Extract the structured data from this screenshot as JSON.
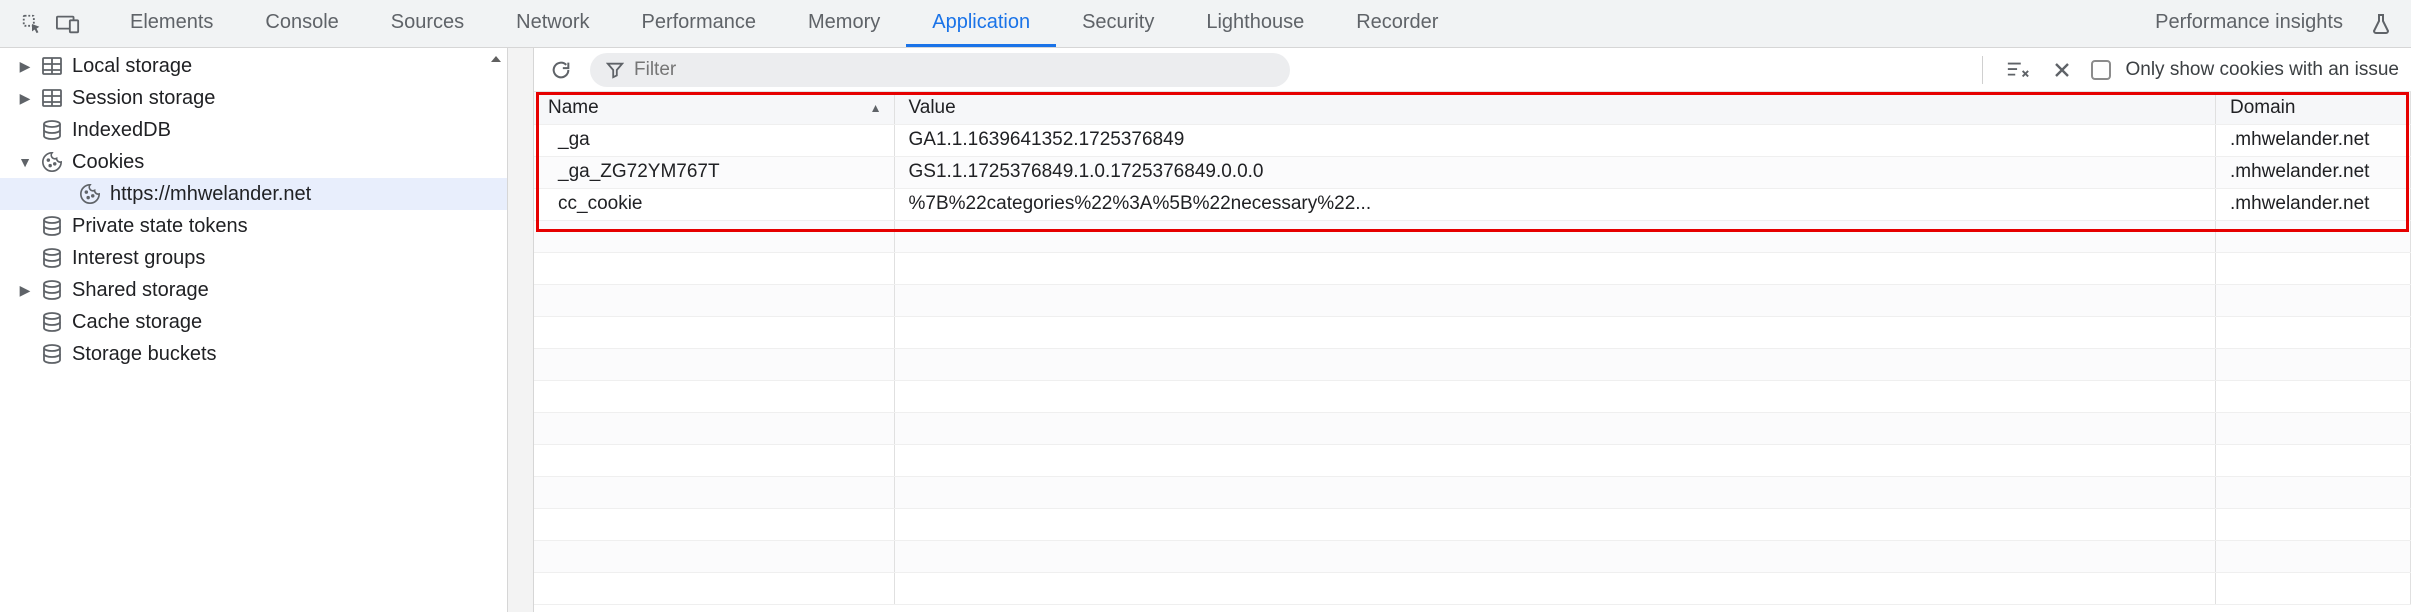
{
  "tabs": {
    "elements": "Elements",
    "console": "Console",
    "sources": "Sources",
    "network": "Network",
    "performance": "Performance",
    "memory": "Memory",
    "application": "Application",
    "security": "Security",
    "lighthouse": "Lighthouse",
    "recorder": "Recorder",
    "perf_insights": "Performance insights"
  },
  "active_tab": "application",
  "sidebar": {
    "items": [
      {
        "label": "Local storage",
        "icon": "db-table",
        "arrow": "right",
        "indent": 1
      },
      {
        "label": "Session storage",
        "icon": "db-table",
        "arrow": "right",
        "indent": 1
      },
      {
        "label": "IndexedDB",
        "icon": "db",
        "arrow": "",
        "indent": 1
      },
      {
        "label": "Cookies",
        "icon": "cookie",
        "arrow": "down",
        "indent": 1
      },
      {
        "label": "https://mhwelander.net",
        "icon": "cookie",
        "arrow": "",
        "indent": 2,
        "selected": true
      },
      {
        "label": "Private state tokens",
        "icon": "db",
        "arrow": "",
        "indent": 1
      },
      {
        "label": "Interest groups",
        "icon": "db",
        "arrow": "",
        "indent": 1
      },
      {
        "label": "Shared storage",
        "icon": "db",
        "arrow": "right",
        "indent": 1
      },
      {
        "label": "Cache storage",
        "icon": "db",
        "arrow": "",
        "indent": 1
      },
      {
        "label": "Storage buckets",
        "icon": "db",
        "arrow": "",
        "indent": 1
      }
    ]
  },
  "toolbar": {
    "filter_placeholder": "Filter",
    "only_show_label": "Only show cookies with an issue"
  },
  "columns": {
    "name": "Name",
    "value": "Value",
    "domain": "Domain"
  },
  "cookies": [
    {
      "name": "_ga",
      "value": "GA1.1.1639641352.1725376849",
      "domain": ".mhwelander.net"
    },
    {
      "name": "_ga_ZG72YM767T",
      "value": "GS1.1.1725376849.1.0.1725376849.0.0.0",
      "domain": ".mhwelander.net"
    },
    {
      "name": "cc_cookie",
      "value": "%7B%22categories%22%3A%5B%22necessary%22...",
      "domain": ".mhwelander.net"
    }
  ]
}
